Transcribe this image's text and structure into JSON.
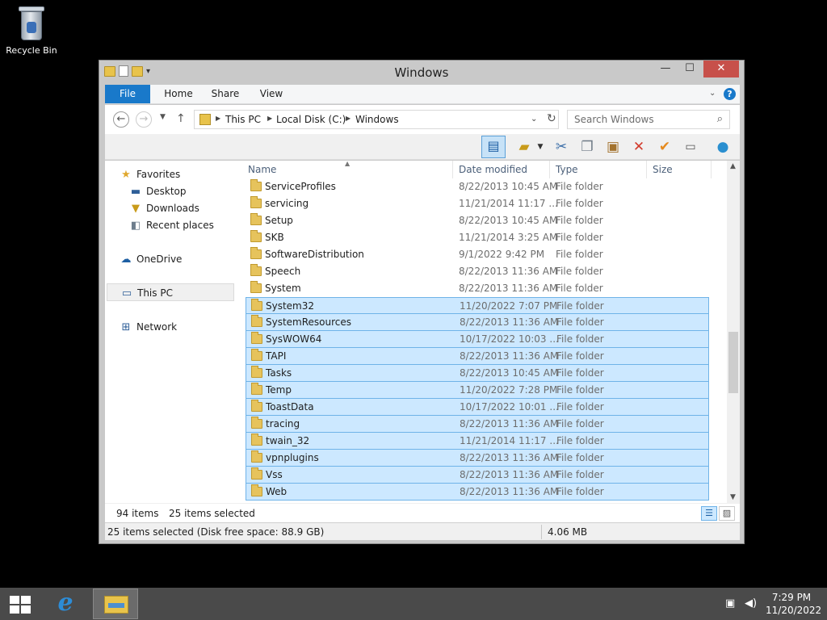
{
  "desktop": {
    "recycle_bin_label": "Recycle Bin"
  },
  "window": {
    "title": "Windows",
    "controls": {
      "minimize": "—",
      "maximize": "☐",
      "close": "✕"
    }
  },
  "ribbon": {
    "tabs": [
      "File",
      "Home",
      "Share",
      "View"
    ],
    "help": "?"
  },
  "navigation": {
    "breadcrumb": [
      "This PC",
      "Local Disk (C:)",
      "Windows"
    ],
    "search_placeholder": "Search Windows"
  },
  "toolbar_icons": [
    "preview-pane-icon",
    "favorite-folder-icon",
    "cut-icon",
    "copy-icon",
    "paste-icon",
    "delete-icon",
    "properties-icon",
    "rename-icon",
    "globe-icon"
  ],
  "sidebar": {
    "items": [
      {
        "label": "Favorites",
        "icon": "star-icon"
      },
      {
        "label": "Desktop",
        "icon": "desktop-icon"
      },
      {
        "label": "Downloads",
        "icon": "downloads-icon"
      },
      {
        "label": "Recent places",
        "icon": "recent-places-icon"
      },
      {
        "label": "OneDrive",
        "icon": "cloud-icon"
      },
      {
        "label": "This PC",
        "icon": "computer-icon"
      },
      {
        "label": "Network",
        "icon": "network-icon"
      }
    ]
  },
  "columns": {
    "name": "Name",
    "date": "Date modified",
    "type": "Type",
    "size": "Size"
  },
  "files": [
    {
      "name": "ServiceProfiles",
      "date": "8/22/2013 10:45 AM",
      "type": "File folder",
      "selected": false
    },
    {
      "name": "servicing",
      "date": "11/21/2014 11:17 ...",
      "type": "File folder",
      "selected": false
    },
    {
      "name": "Setup",
      "date": "8/22/2013 10:45 AM",
      "type": "File folder",
      "selected": false
    },
    {
      "name": "SKB",
      "date": "11/21/2014 3:25 AM",
      "type": "File folder",
      "selected": false
    },
    {
      "name": "SoftwareDistribution",
      "date": "9/1/2022 9:42 PM",
      "type": "File folder",
      "selected": false
    },
    {
      "name": "Speech",
      "date": "8/22/2013 11:36 AM",
      "type": "File folder",
      "selected": false
    },
    {
      "name": "System",
      "date": "8/22/2013 11:36 AM",
      "type": "File folder",
      "selected": false
    },
    {
      "name": "System32",
      "date": "11/20/2022 7:07 PM",
      "type": "File folder",
      "selected": true
    },
    {
      "name": "SystemResources",
      "date": "8/22/2013 11:36 AM",
      "type": "File folder",
      "selected": true
    },
    {
      "name": "SysWOW64",
      "date": "10/17/2022 10:03 ...",
      "type": "File folder",
      "selected": true
    },
    {
      "name": "TAPI",
      "date": "8/22/2013 11:36 AM",
      "type": "File folder",
      "selected": true
    },
    {
      "name": "Tasks",
      "date": "8/22/2013 10:45 AM",
      "type": "File folder",
      "selected": true
    },
    {
      "name": "Temp",
      "date": "11/20/2022 7:28 PM",
      "type": "File folder",
      "selected": true
    },
    {
      "name": "ToastData",
      "date": "10/17/2022 10:01 ...",
      "type": "File folder",
      "selected": true
    },
    {
      "name": "tracing",
      "date": "8/22/2013 11:36 AM",
      "type": "File folder",
      "selected": true
    },
    {
      "name": "twain_32",
      "date": "11/21/2014 11:17 ...",
      "type": "File folder",
      "selected": true
    },
    {
      "name": "vpnplugins",
      "date": "8/22/2013 11:36 AM",
      "type": "File folder",
      "selected": true
    },
    {
      "name": "Vss",
      "date": "8/22/2013 11:36 AM",
      "type": "File folder",
      "selected": true
    },
    {
      "name": "Web",
      "date": "8/22/2013 11:36 AM",
      "type": "File folder",
      "selected": true
    }
  ],
  "status": {
    "item_count": "94 items",
    "selected_count": "25 items selected",
    "details_text": "25 items selected (Disk free space: 88.9 GB)",
    "size_text": "4.06 MB"
  },
  "taskbar": {
    "time": "7:29 PM",
    "date": "11/20/2022"
  },
  "colors": {
    "file_tab": "#1979ca",
    "selection_fill": "#cce8ff",
    "selection_border": "#6fb3e8",
    "close_button": "#c7504a",
    "taskbar": "#4a4a4a"
  }
}
